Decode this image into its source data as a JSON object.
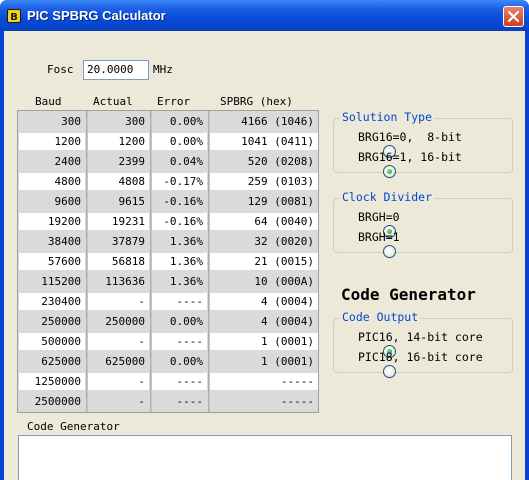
{
  "window": {
    "title": "PIC SPBRG Calculator"
  },
  "fosc": {
    "label": "Fosc",
    "value": "20.0000",
    "unit": "MHz"
  },
  "table": {
    "headers": {
      "baud": "Baud",
      "actual": "Actual",
      "error": "Error",
      "spbrg": "SPBRG (hex)"
    },
    "rows": [
      {
        "baud": "300",
        "actual": "300",
        "error": "0.00%",
        "spbrg": "4166 (1046)"
      },
      {
        "baud": "1200",
        "actual": "1200",
        "error": "0.00%",
        "spbrg": "1041 (0411)"
      },
      {
        "baud": "2400",
        "actual": "2399",
        "error": "0.04%",
        "spbrg": "520 (0208)"
      },
      {
        "baud": "4800",
        "actual": "4808",
        "error": "-0.17%",
        "spbrg": "259 (0103)"
      },
      {
        "baud": "9600",
        "actual": "9615",
        "error": "-0.16%",
        "spbrg": "129 (0081)"
      },
      {
        "baud": "19200",
        "actual": "19231",
        "error": "-0.16%",
        "spbrg": "64 (0040)"
      },
      {
        "baud": "38400",
        "actual": "37879",
        "error": "1.36%",
        "spbrg": "32 (0020)"
      },
      {
        "baud": "57600",
        "actual": "56818",
        "error": "1.36%",
        "spbrg": "21 (0015)"
      },
      {
        "baud": "115200",
        "actual": "113636",
        "error": "1.36%",
        "spbrg": "10 (000A)"
      },
      {
        "baud": "230400",
        "actual": "-",
        "error": "----",
        "spbrg": "4 (0004)"
      },
      {
        "baud": "250000",
        "actual": "250000",
        "error": "0.00%",
        "spbrg": "4 (0004)"
      },
      {
        "baud": "500000",
        "actual": "-",
        "error": "----",
        "spbrg": "1 (0001)"
      },
      {
        "baud": "625000",
        "actual": "625000",
        "error": "0.00%",
        "spbrg": "1 (0001)"
      },
      {
        "baud": "1250000",
        "actual": "-",
        "error": "----",
        "spbrg": "-----"
      },
      {
        "baud": "2500000",
        "actual": "-",
        "error": "----",
        "spbrg": "-----"
      }
    ]
  },
  "solution_type": {
    "title": "Solution Type",
    "options": [
      {
        "label": "BRG16=0,  8-bit",
        "selected": false
      },
      {
        "label": "BRG16=1, 16-bit",
        "selected": true
      }
    ]
  },
  "clock_divider": {
    "title": "Clock Divider",
    "options": [
      {
        "label": "BRGH=0",
        "selected": true
      },
      {
        "label": "BRGH=1",
        "selected": false
      }
    ]
  },
  "code_generator_heading": "Code Generator",
  "code_output": {
    "title": "Code Output",
    "options": [
      {
        "label": "PIC16, 14-bit core",
        "selected": true
      },
      {
        "label": "PIC18, 16-bit core",
        "selected": false
      }
    ]
  },
  "code_generator_box": {
    "label": "Code Generator",
    "content": ""
  },
  "colors": {
    "titlebar": "#0a4ed9",
    "client": "#ece9d8",
    "group_title": "#0046d5"
  },
  "icons": {
    "app": "app-icon",
    "close": "close-icon"
  }
}
